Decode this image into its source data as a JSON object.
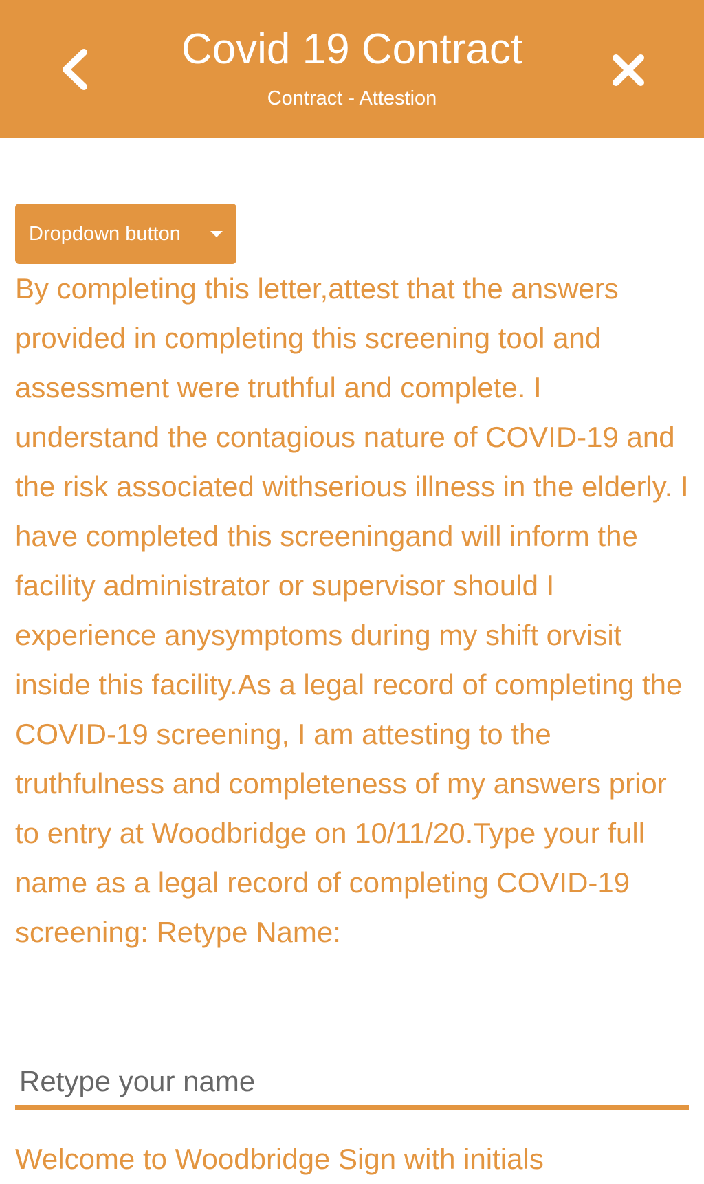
{
  "header": {
    "title": "Covid 19 Contract",
    "subtitle": "Contract - Attestion",
    "back_icon": "chevron-left-icon",
    "close_icon": "close-icon",
    "background_color": "#E39540"
  },
  "dropdown": {
    "label": "Dropdown button",
    "icon": "caret-down-icon"
  },
  "attestation": {
    "text": "By completing this letter,attest that the answers provided in completing this screening tool and assessment were truthful and complete. I understand the contagious nature of COVID-19 and the risk associated withserious illness in the elderly. I have completed this screeningand will inform the facility administrator or supervisor should I experience anysymptoms during my shift orvisit inside this facility.As a legal record of completing the COVID-19 screening, I am attesting to the truthfulness and completeness of my answers prior to entry at Woodbridge on 10/11/20.Type your full name as a legal record of completing COVID-19 screening: Retype Name:"
  },
  "name_field": {
    "value": "",
    "placeholder": "Retype your name"
  },
  "footer": {
    "welcome_text": "Welcome to Woodbridge Sign with initials"
  },
  "colors": {
    "accent": "#E39540",
    "placeholder": "#676767"
  }
}
